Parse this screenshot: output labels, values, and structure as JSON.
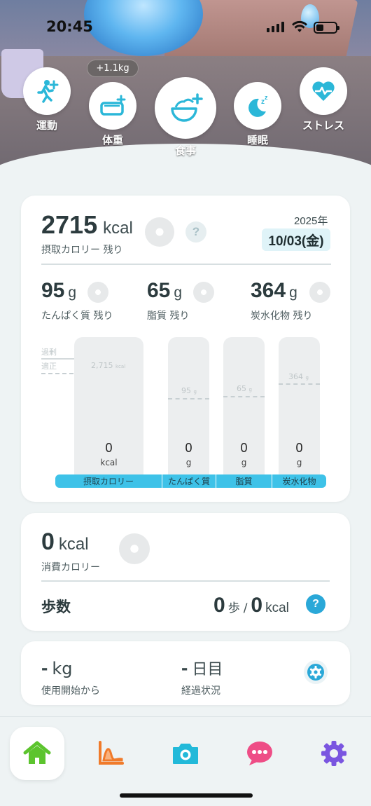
{
  "status_bar": {
    "time": "20:45"
  },
  "quick_actions": [
    {
      "id": "exercise",
      "label": "運動",
      "icon": "running-plus-icon"
    },
    {
      "id": "weight",
      "label": "体重",
      "icon": "scale-plus-icon",
      "badge": "+1.1kg"
    },
    {
      "id": "meal",
      "label": "食事",
      "icon": "bowl-plus-icon"
    },
    {
      "id": "sleep",
      "label": "睡眠",
      "icon": "moon-zz-icon"
    },
    {
      "id": "stress",
      "label": "ストレス",
      "icon": "heart-pulse-icon"
    }
  ],
  "intake_card": {
    "calories_value": "2715",
    "calories_unit": "kcal",
    "calories_label": "摂取カロリー 残り",
    "year": "2025年",
    "date": "10/03(金)",
    "macros": [
      {
        "value": "95",
        "unit": "g",
        "label": "たんぱく質 残り"
      },
      {
        "value": "65",
        "unit": "g",
        "label": "脂質 残り"
      },
      {
        "value": "364",
        "unit": "g",
        "label": "炭水化物 残り"
      }
    ],
    "chart": {
      "level_excess": "過剰",
      "level_proper": "適正",
      "bars": [
        {
          "target_label": "2,715",
          "target_unit": "kcal",
          "value": "0",
          "unit": "kcal",
          "legend": "摂取カロリー"
        },
        {
          "target_label": "95",
          "target_unit": "g",
          "value": "0",
          "unit": "g",
          "legend": "たんぱく質"
        },
        {
          "target_label": "65",
          "target_unit": "g",
          "value": "0",
          "unit": "g",
          "legend": "脂質"
        },
        {
          "target_label": "364",
          "target_unit": "g",
          "value": "0",
          "unit": "g",
          "legend": "炭水化物"
        }
      ]
    }
  },
  "burn_card": {
    "calories_value": "0",
    "calories_unit": "kcal",
    "calories_label": "消費カロリー",
    "steps_label": "歩数",
    "steps_value": "0",
    "steps_unit": "歩",
    "steps_sep": "/",
    "steps_kcal_value": "0",
    "steps_kcal_unit": "kcal",
    "help_glyph": "?"
  },
  "progress_card": {
    "weight_value": "-",
    "weight_unit": "kg",
    "weight_label": "使用開始から",
    "days_value": "-",
    "days_unit": "日目",
    "days_label": "経過状況"
  },
  "help_glyph": "?",
  "nav": [
    {
      "id": "home",
      "icon": "home-icon",
      "color": "#5cc42e"
    },
    {
      "id": "graph",
      "icon": "graph-icon",
      "color": "#f07a2a"
    },
    {
      "id": "camera",
      "icon": "camera-icon",
      "color": "#22b9d9"
    },
    {
      "id": "chat",
      "icon": "chat-icon",
      "color": "#ee4d86"
    },
    {
      "id": "settings",
      "icon": "gear-icon",
      "color": "#7a55e0"
    }
  ],
  "colors": {
    "accent": "#3ec2e8",
    "date_bg": "#dff3f8",
    "background": "#eef3f4"
  }
}
